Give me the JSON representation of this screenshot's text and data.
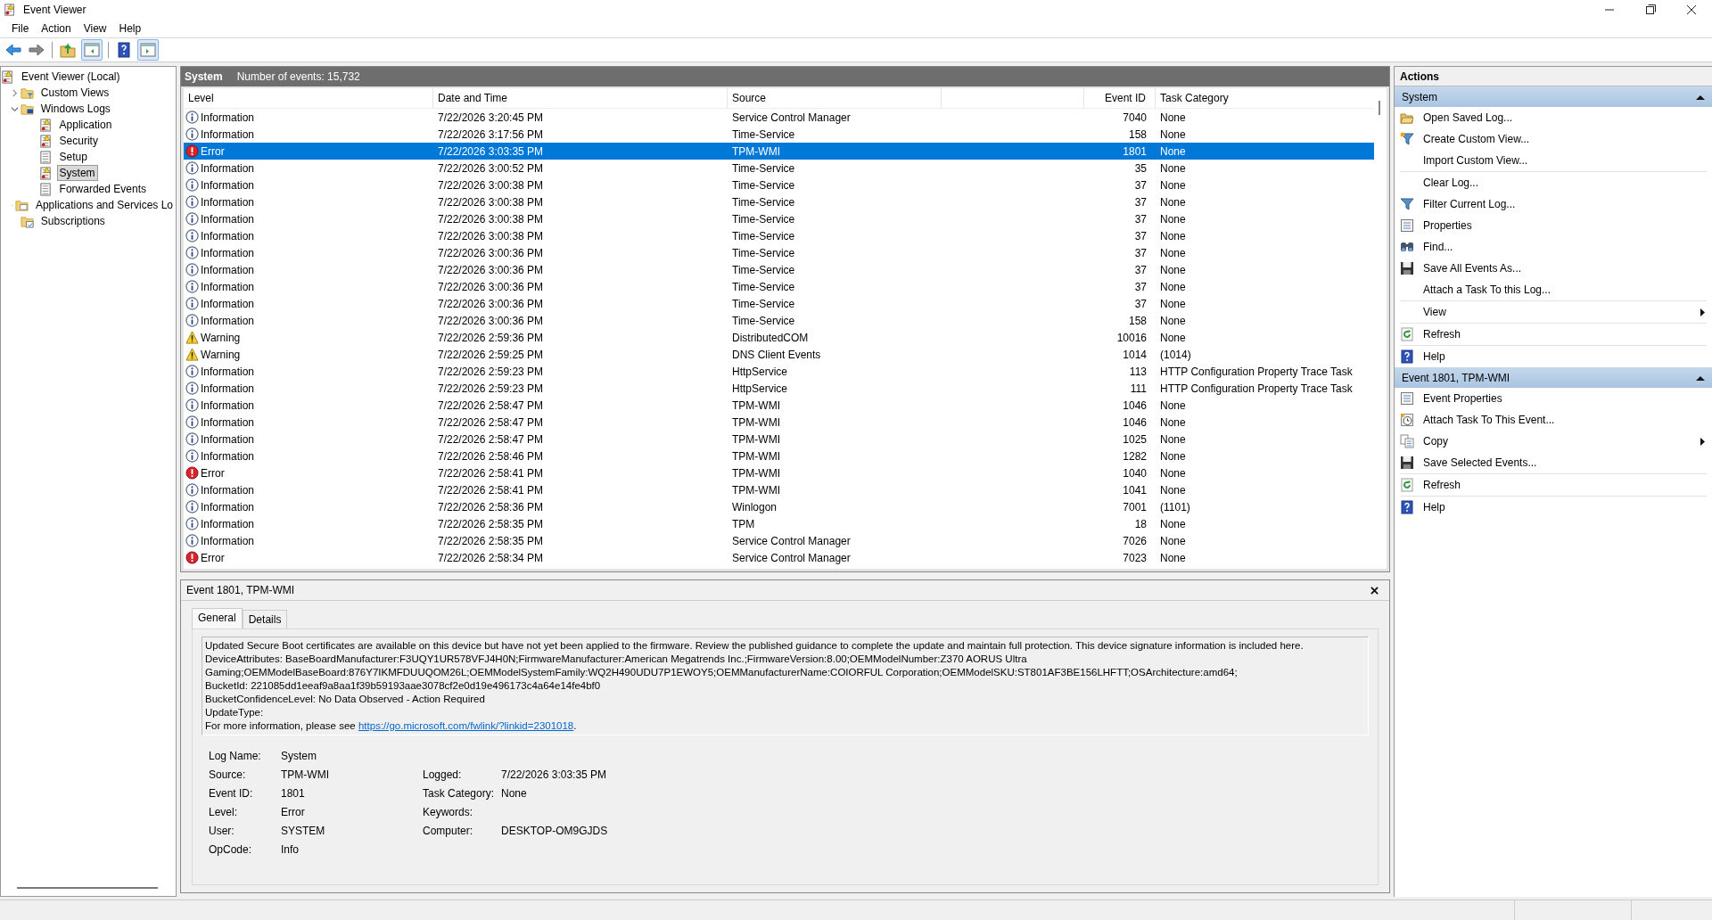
{
  "window": {
    "title": "Event Viewer"
  },
  "menu": [
    "File",
    "Action",
    "View",
    "Help"
  ],
  "tree": [
    {
      "label": "Event Viewer (Local)",
      "kind": "root",
      "selected": false,
      "children": [
        {
          "label": "Custom Views",
          "kind": "filterfolder",
          "selected": false,
          "expanded": false
        },
        {
          "label": "Windows Logs",
          "kind": "logsfolder",
          "selected": false,
          "expanded": true,
          "children": [
            {
              "label": "Application",
              "kind": "log",
              "selected": false
            },
            {
              "label": "Security",
              "kind": "log",
              "selected": false
            },
            {
              "label": "Setup",
              "kind": "plainlog",
              "selected": false
            },
            {
              "label": "System",
              "kind": "log",
              "selected": true
            },
            {
              "label": "Forwarded Events",
              "kind": "plainlog",
              "selected": false
            }
          ]
        },
        {
          "label": "Applications and Services Lo",
          "kind": "folder",
          "selected": false,
          "expanded": false
        },
        {
          "label": "Subscriptions",
          "kind": "subfolder",
          "selected": false
        }
      ]
    }
  ],
  "log_header": {
    "title": "System",
    "count": "Number of events: 15,732"
  },
  "table": {
    "columns": [
      "Level",
      "Date and Time",
      "Source",
      "Event ID",
      "Task Category"
    ],
    "rows": [
      {
        "kind": "info",
        "level": "Information",
        "date": "7/22/2026 3:20:45 PM",
        "source": "Service Control Manager",
        "id": "7040",
        "category": "None",
        "selected": false
      },
      {
        "kind": "info",
        "level": "Information",
        "date": "7/22/2026 3:17:56 PM",
        "source": "Time-Service",
        "id": "158",
        "category": "None",
        "selected": false
      },
      {
        "kind": "error",
        "level": "Error",
        "date": "7/22/2026 3:03:35 PM",
        "source": "TPM-WMI",
        "id": "1801",
        "category": "None",
        "selected": true
      },
      {
        "kind": "info",
        "level": "Information",
        "date": "7/22/2026 3:00:52 PM",
        "source": "Time-Service",
        "id": "35",
        "category": "None",
        "selected": false
      },
      {
        "kind": "info",
        "level": "Information",
        "date": "7/22/2026 3:00:38 PM",
        "source": "Time-Service",
        "id": "37",
        "category": "None",
        "selected": false
      },
      {
        "kind": "info",
        "level": "Information",
        "date": "7/22/2026 3:00:38 PM",
        "source": "Time-Service",
        "id": "37",
        "category": "None",
        "selected": false
      },
      {
        "kind": "info",
        "level": "Information",
        "date": "7/22/2026 3:00:38 PM",
        "source": "Time-Service",
        "id": "37",
        "category": "None",
        "selected": false
      },
      {
        "kind": "info",
        "level": "Information",
        "date": "7/22/2026 3:00:38 PM",
        "source": "Time-Service",
        "id": "37",
        "category": "None",
        "selected": false
      },
      {
        "kind": "info",
        "level": "Information",
        "date": "7/22/2026 3:00:36 PM",
        "source": "Time-Service",
        "id": "37",
        "category": "None",
        "selected": false
      },
      {
        "kind": "info",
        "level": "Information",
        "date": "7/22/2026 3:00:36 PM",
        "source": "Time-Service",
        "id": "37",
        "category": "None",
        "selected": false
      },
      {
        "kind": "info",
        "level": "Information",
        "date": "7/22/2026 3:00:36 PM",
        "source": "Time-Service",
        "id": "37",
        "category": "None",
        "selected": false
      },
      {
        "kind": "info",
        "level": "Information",
        "date": "7/22/2026 3:00:36 PM",
        "source": "Time-Service",
        "id": "37",
        "category": "None",
        "selected": false
      },
      {
        "kind": "info",
        "level": "Information",
        "date": "7/22/2026 3:00:36 PM",
        "source": "Time-Service",
        "id": "158",
        "category": "None",
        "selected": false
      },
      {
        "kind": "warning",
        "level": "Warning",
        "date": "7/22/2026 2:59:36 PM",
        "source": "DistributedCOM",
        "id": "10016",
        "category": "None",
        "selected": false
      },
      {
        "kind": "warning",
        "level": "Warning",
        "date": "7/22/2026 2:59:25 PM",
        "source": "DNS Client Events",
        "id": "1014",
        "category": "(1014)",
        "selected": false
      },
      {
        "kind": "info",
        "level": "Information",
        "date": "7/22/2026 2:59:23 PM",
        "source": "HttpService",
        "id": "113",
        "category": "HTTP Configuration Property Trace Task",
        "selected": false
      },
      {
        "kind": "info",
        "level": "Information",
        "date": "7/22/2026 2:59:23 PM",
        "source": "HttpService",
        "id": "111",
        "category": "HTTP Configuration Property Trace Task",
        "selected": false
      },
      {
        "kind": "info",
        "level": "Information",
        "date": "7/22/2026 2:58:47 PM",
        "source": "TPM-WMI",
        "id": "1046",
        "category": "None",
        "selected": false
      },
      {
        "kind": "info",
        "level": "Information",
        "date": "7/22/2026 2:58:47 PM",
        "source": "TPM-WMI",
        "id": "1046",
        "category": "None",
        "selected": false
      },
      {
        "kind": "info",
        "level": "Information",
        "date": "7/22/2026 2:58:47 PM",
        "source": "TPM-WMI",
        "id": "1025",
        "category": "None",
        "selected": false
      },
      {
        "kind": "info",
        "level": "Information",
        "date": "7/22/2026 2:58:46 PM",
        "source": "TPM-WMI",
        "id": "1282",
        "category": "None",
        "selected": false
      },
      {
        "kind": "error",
        "level": "Error",
        "date": "7/22/2026 2:58:41 PM",
        "source": "TPM-WMI",
        "id": "1040",
        "category": "None",
        "selected": false
      },
      {
        "kind": "info",
        "level": "Information",
        "date": "7/22/2026 2:58:41 PM",
        "source": "TPM-WMI",
        "id": "1041",
        "category": "None",
        "selected": false
      },
      {
        "kind": "info",
        "level": "Information",
        "date": "7/22/2026 2:58:36 PM",
        "source": "Winlogon",
        "id": "7001",
        "category": "(1101)",
        "selected": false
      },
      {
        "kind": "info",
        "level": "Information",
        "date": "7/22/2026 2:58:35 PM",
        "source": "TPM",
        "id": "18",
        "category": "None",
        "selected": false
      },
      {
        "kind": "info",
        "level": "Information",
        "date": "7/22/2026 2:58:35 PM",
        "source": "Service Control Manager",
        "id": "7026",
        "category": "None",
        "selected": false
      },
      {
        "kind": "error",
        "level": "Error",
        "date": "7/22/2026 2:58:34 PM",
        "source": "Service Control Manager",
        "id": "7023",
        "category": "None",
        "selected": false
      }
    ]
  },
  "detail": {
    "title": "Event 1801, TPM-WMI",
    "tabs": [
      {
        "label": "General",
        "selected": true
      },
      {
        "label": "Details",
        "selected": false
      }
    ],
    "description_lines": [
      "Updated Secure Boot certificates are available on this device but have not yet been applied to the firmware. Review the published guidance to complete the update and maintain full protection. This device signature information is included here.",
      "DeviceAttributes: BaseBoardManufacturer:F3UQY1UR578VFJ4H0N;FirmwareManufacturer:American Megatrends Inc.;FirmwareVersion:8.00;OEMModelNumber:Z370 AORUS Ultra Gaming;OEMModelBaseBoard:876Y7IKMFDUUQOM26L;OEMModelSystemFamily:WQ2H490UDU7P1EWOY5;OEMManufacturerName:COIORFUL Corporation;OEMModelSKU:ST801AF3BE156LHFTT;OSArchitecture:amd64;",
      "BucketId: 221085dd1eeaf9a8aa1f39b59193aae3078cf2e0d19e496173c4a64e14fe4bf0",
      "BucketConfidenceLevel: No Data Observed - Action Required",
      "UpdateType:"
    ],
    "more_info": {
      "prefix": "For more information, please see ",
      "link": "https://go.microsoft.com/fwlink/?linkid=2301018",
      "suffix": "."
    },
    "fields_left": [
      {
        "label": "Log Name:",
        "value": "System"
      },
      {
        "label": "Source:",
        "value": "TPM-WMI"
      },
      {
        "label": "Event ID:",
        "value": "1801"
      },
      {
        "label": "Level:",
        "value": "Error"
      },
      {
        "label": "User:",
        "value": "SYSTEM"
      },
      {
        "label": "OpCode:",
        "value": "Info"
      }
    ],
    "fields_right": [
      {
        "label": "Logged:",
        "value": "7/22/2026 3:03:35 PM"
      },
      {
        "label": "Task Category:",
        "value": "None"
      },
      {
        "label": "Keywords:"
      },
      {
        "label": "Computer:",
        "value": "DESKTOP-OM9GJDS"
      }
    ]
  },
  "actions": {
    "title": "Actions",
    "sections": [
      {
        "title": "System",
        "groups": [
          [
            {
              "label": "Open Saved Log...",
              "kind": "folder",
              "submenu": false
            },
            {
              "label": "Create Custom View...",
              "kind": "funnelstar",
              "submenu": false
            },
            {
              "label": "Import Custom View...",
              "kind": "none",
              "submenu": false
            }
          ],
          [
            {
              "label": "Clear Log...",
              "kind": "none",
              "submenu": false
            },
            {
              "label": "Filter Current Log...",
              "kind": "funnel",
              "submenu": false
            },
            {
              "label": "Properties",
              "kind": "properties",
              "submenu": false
            },
            {
              "label": "Find...",
              "kind": "binoculars",
              "submenu": false
            },
            {
              "label": "Save All Events As...",
              "kind": "disk",
              "submenu": false
            },
            {
              "label": "Attach a Task To this Log...",
              "kind": "none",
              "submenu": false
            }
          ],
          [
            {
              "label": "View",
              "kind": "none",
              "submenu": true
            }
          ],
          [
            {
              "label": "Refresh",
              "kind": "refresh",
              "submenu": false
            }
          ],
          [
            {
              "label": "Help",
              "kind": "help",
              "submenu": false
            }
          ]
        ]
      },
      {
        "title": "Event 1801, TPM-WMI",
        "groups": [
          [
            {
              "label": "Event Properties",
              "kind": "properties",
              "submenu": false
            },
            {
              "label": "Attach Task To This Event...",
              "kind": "clock",
              "submenu": false
            },
            {
              "label": "Copy",
              "kind": "copy",
              "submenu": true
            },
            {
              "label": "Save Selected Events...",
              "kind": "disk",
              "submenu": false
            }
          ],
          [
            {
              "label": "Refresh",
              "kind": "refresh",
              "submenu": false
            }
          ],
          [
            {
              "label": "Help",
              "kind": "help",
              "submenu": false
            }
          ]
        ]
      }
    ]
  }
}
